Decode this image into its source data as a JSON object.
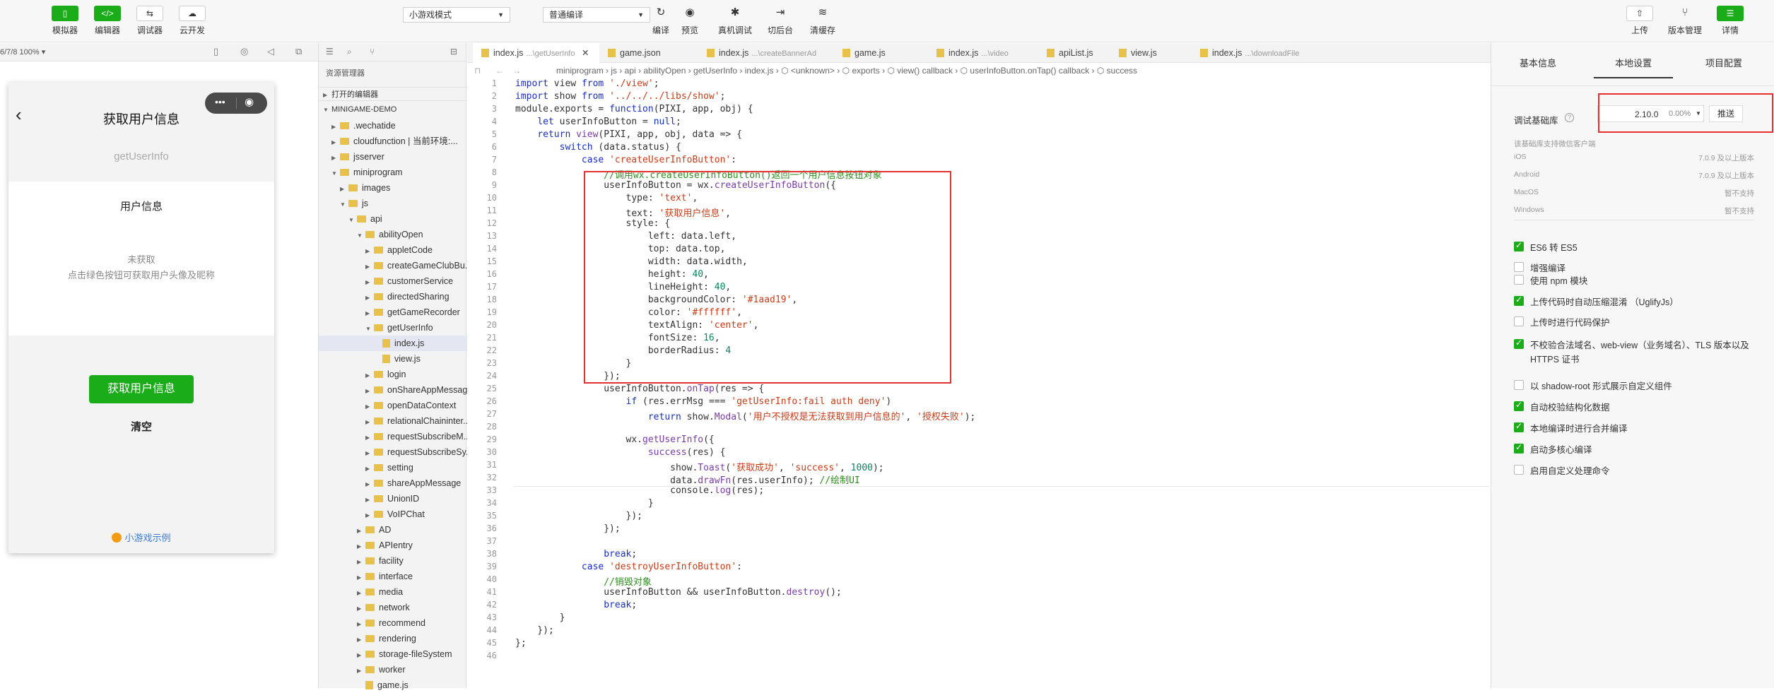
{
  "toolbar": {
    "simulator": "模拟器",
    "editor": "编辑器",
    "debugger": "调试器",
    "cloud": "云开发",
    "mode_select": "小游戏模式",
    "compile_select": "普通编译",
    "compile": "编译",
    "preview": "预览",
    "real_debug": "真机调试",
    "background": "切后台",
    "clear_cache": "清缓存",
    "upload": "上传",
    "version": "版本管理",
    "details": "详情"
  },
  "simulator": {
    "device_zoom": "6/7/8 100% ▾",
    "page_title": "获取用户信息",
    "api_name": "getUserInfo",
    "section_label": "用户信息",
    "status": "未获取",
    "hint": "点击绿色按钮可获取用户头像及昵称",
    "get_button": "获取用户信息",
    "clear_button": "清空",
    "footer": "小游戏示例"
  },
  "explorer": {
    "title": "资源管理器",
    "open_editors": "打开的编辑器",
    "project": "MINIGAME-DEMO",
    "items": [
      {
        "label": ".wechatide",
        "depth": 1,
        "type": "folder",
        "open": false
      },
      {
        "label": "cloudfunction | 当前环境:...",
        "depth": 1,
        "type": "folder",
        "open": false
      },
      {
        "label": "jsserver",
        "depth": 1,
        "type": "folder",
        "open": false
      },
      {
        "label": "miniprogram",
        "depth": 1,
        "type": "folder",
        "open": true
      },
      {
        "label": "images",
        "depth": 2,
        "type": "folder",
        "open": false
      },
      {
        "label": "js",
        "depth": 2,
        "type": "folder",
        "open": true
      },
      {
        "label": "api",
        "depth": 3,
        "type": "folder",
        "open": true
      },
      {
        "label": "abilityOpen",
        "depth": 4,
        "type": "folder",
        "open": true
      },
      {
        "label": "appletCode",
        "depth": 5,
        "type": "folder",
        "open": false
      },
      {
        "label": "createGameClubBu...",
        "depth": 5,
        "type": "folder",
        "open": false
      },
      {
        "label": "customerService",
        "depth": 5,
        "type": "folder",
        "open": false
      },
      {
        "label": "directedSharing",
        "depth": 5,
        "type": "folder",
        "open": false
      },
      {
        "label": "getGameRecorder",
        "depth": 5,
        "type": "folder",
        "open": false
      },
      {
        "label": "getUserInfo",
        "depth": 5,
        "type": "folder",
        "open": true
      },
      {
        "label": "index.js",
        "depth": 6,
        "type": "file",
        "open": false,
        "selected": true
      },
      {
        "label": "view.js",
        "depth": 6,
        "type": "file",
        "open": false
      },
      {
        "label": "login",
        "depth": 5,
        "type": "folder",
        "open": false
      },
      {
        "label": "onShareAppMessage",
        "depth": 5,
        "type": "folder",
        "open": false
      },
      {
        "label": "openDataContext",
        "depth": 5,
        "type": "folder",
        "open": false
      },
      {
        "label": "relationalChaininter...",
        "depth": 5,
        "type": "folder",
        "open": false
      },
      {
        "label": "requestSubscribeM...",
        "depth": 5,
        "type": "folder",
        "open": false
      },
      {
        "label": "requestSubscribeSy...",
        "depth": 5,
        "type": "folder",
        "open": false
      },
      {
        "label": "setting",
        "depth": 5,
        "type": "folder",
        "open": false
      },
      {
        "label": "shareAppMessage",
        "depth": 5,
        "type": "folder",
        "open": false
      },
      {
        "label": "UnionID",
        "depth": 5,
        "type": "folder",
        "open": false
      },
      {
        "label": "VoIPChat",
        "depth": 5,
        "type": "folder",
        "open": false
      },
      {
        "label": "AD",
        "depth": 4,
        "type": "folder",
        "open": false
      },
      {
        "label": "APIentry",
        "depth": 4,
        "type": "folder",
        "open": false
      },
      {
        "label": "facility",
        "depth": 4,
        "type": "folder",
        "open": false
      },
      {
        "label": "interface",
        "depth": 4,
        "type": "folder",
        "open": false
      },
      {
        "label": "media",
        "depth": 4,
        "type": "folder",
        "open": false
      },
      {
        "label": "network",
        "depth": 4,
        "type": "folder",
        "open": false
      },
      {
        "label": "recommend",
        "depth": 4,
        "type": "folder",
        "open": false
      },
      {
        "label": "rendering",
        "depth": 4,
        "type": "folder",
        "open": false
      },
      {
        "label": "storage-fileSystem",
        "depth": 4,
        "type": "folder",
        "open": false
      },
      {
        "label": "worker",
        "depth": 4,
        "type": "folder",
        "open": false
      },
      {
        "label": "game.js",
        "depth": 4,
        "type": "file",
        "open": false
      }
    ]
  },
  "editor": {
    "tabs": [
      {
        "name": "index.js",
        "path": "...\\getUserInfo",
        "active": true
      },
      {
        "name": "game.json",
        "path": "",
        "active": false
      },
      {
        "name": "index.js",
        "path": "...\\createBannerAd",
        "active": false
      },
      {
        "name": "game.js",
        "path": "",
        "active": false
      },
      {
        "name": "index.js",
        "path": "...\\video",
        "active": false
      },
      {
        "name": "apiList.js",
        "path": "",
        "active": false
      },
      {
        "name": "view.js",
        "path": "",
        "active": false
      },
      {
        "name": "index.js",
        "path": "...\\downloadFile",
        "active": false
      }
    ],
    "breadcrumb": "miniprogram › js › api › abilityOpen › getUserInfo › index.js › ⬡ <unknown> › ⬡ exports › ⬡ view() callback › ⬡ userInfoButton.onTap() callback › ⬡ success",
    "lines": [
      "import view from './view';",
      "import show from '../../../libs/show';",
      "module.exports = function(PIXI, app, obj) {",
      "    let userInfoButton = null;",
      "    return view(PIXI, app, obj, data => {",
      "        switch (data.status) {",
      "            case 'createUserInfoButton':",
      "                //调用wx.createUserInfoButton()返回一个用户信息按钮对象",
      "                userInfoButton = wx.createUserInfoButton({",
      "                    type: 'text',",
      "                    text: '获取用户信息',",
      "                    style: {",
      "                        left: data.left,",
      "                        top: data.top,",
      "                        width: data.width,",
      "                        height: 40,",
      "                        lineHeight: 40,",
      "                        backgroundColor: '#1aad19',",
      "                        color: '#ffffff',",
      "                        textAlign: 'center',",
      "                        fontSize: 16,",
      "                        borderRadius: 4",
      "                    }",
      "                });",
      "                userInfoButton.onTap(res => {",
      "                    if (res.errMsg === 'getUserInfo:fail auth deny')",
      "                        return show.Modal('用户不授权是无法获取到用户信息的', '授权失败');",
      "",
      "                    wx.getUserInfo({",
      "                        success(res) {",
      "                            show.Toast('获取成功', 'success', 1000);",
      "                            data.drawFn(res.userInfo); //绘制UI",
      "                            console.log(res);",
      "                        }",
      "                    });",
      "                });",
      "",
      "                break;",
      "            case 'destroyUserInfoButton':",
      "                //销毁对象",
      "                userInfoButton && userInfoButton.destroy();",
      "                break;",
      "        }",
      "    });",
      "};",
      ""
    ]
  },
  "settings": {
    "tab_basic": "基本信息",
    "tab_local": "本地设置",
    "tab_project": "项目配置",
    "lib_label": "调试基础库",
    "lib_version": "2.10.0",
    "lib_percent": "0.00%",
    "push_button": "推送",
    "support_note": "该基础库支持微信客户端",
    "platforms": [
      {
        "name": "iOS",
        "value": "7.0.9 及以上版本"
      },
      {
        "name": "Android",
        "value": "7.0.9 及以上版本"
      },
      {
        "name": "MacOS",
        "value": "暂不支持"
      },
      {
        "name": "Windows",
        "value": "暂不支持"
      }
    ],
    "options": [
      {
        "label": "ES6 转 ES5",
        "checked": true
      },
      {
        "label": "增强编译",
        "checked": false
      },
      {
        "label": "使用 npm 模块",
        "checked": false
      },
      {
        "label": "上传代码时自动压缩混淆 （UglifyJs）",
        "checked": true
      },
      {
        "label": "上传时进行代码保护",
        "checked": false
      },
      {
        "label": "不校验合法域名、web-view（业务域名）、TLS 版本以及 HTTPS 证书",
        "checked": true
      },
      {
        "label": "以 shadow-root 形式展示自定义组件",
        "checked": false
      },
      {
        "label": "自动校验结构化数据",
        "checked": true
      },
      {
        "label": "本地编译时进行合并编译",
        "checked": true
      },
      {
        "label": "启动多核心编译",
        "checked": true
      },
      {
        "label": "启用自定义处理命令",
        "checked": false
      }
    ]
  },
  "colors": {
    "accent": "#1aad19",
    "highlight_box": "#e53030"
  }
}
